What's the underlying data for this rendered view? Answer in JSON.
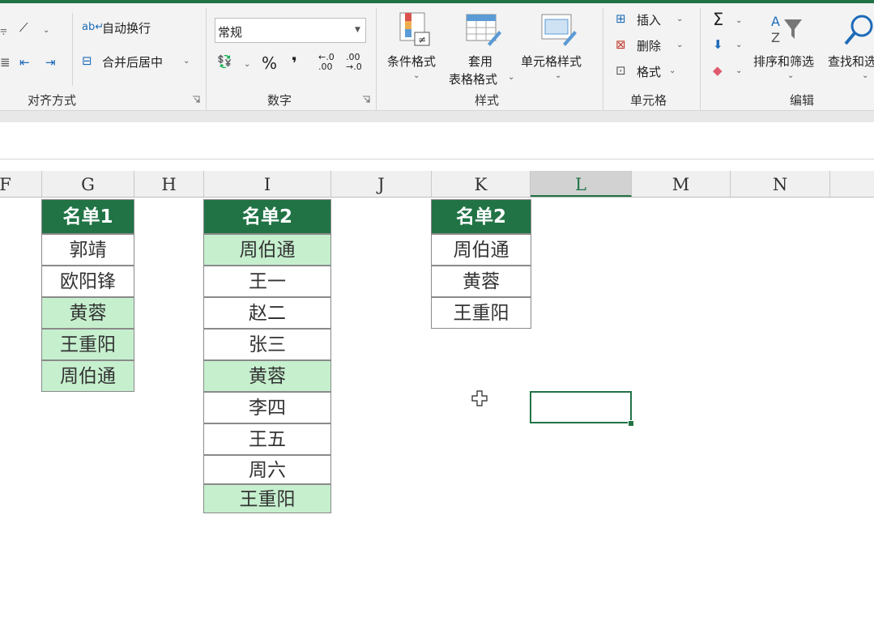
{
  "ribbon": {
    "alignment": {
      "label": "对齐方式",
      "wrap_text": "自动换行",
      "merge_center": "合并后居中"
    },
    "number": {
      "label": "数字",
      "format_value": "常规",
      "percent_symbol": "%",
      "comma_symbol": "❜"
    },
    "styles": {
      "label": "样式",
      "conditional_format": "条件格式",
      "table_format_line1": "套用",
      "table_format_line2": "表格格式",
      "cell_styles": "单元格样式"
    },
    "cells": {
      "label": "单元格",
      "insert": "插入",
      "delete": "删除",
      "format": "格式"
    },
    "editing": {
      "label": "编辑",
      "sum_symbol": "Σ",
      "sort_filter": "排序和筛选",
      "find_select": "查找和选"
    }
  },
  "columns": [
    "F",
    "G",
    "H",
    "I",
    "J",
    "K",
    "L",
    "M",
    "N"
  ],
  "selected_column": "L",
  "list1": {
    "header": "名单1",
    "items": [
      "郭靖",
      "欧阳锋",
      "黄蓉",
      "王重阳",
      "周伯通"
    ],
    "highlighted": [
      false,
      false,
      true,
      true,
      true
    ]
  },
  "list2": {
    "header": "名单2",
    "items": [
      "周伯通",
      "王一",
      "赵二",
      "张三",
      "黄蓉",
      "李四",
      "王五",
      "周六",
      "王重阳"
    ],
    "highlighted": [
      true,
      false,
      false,
      false,
      true,
      false,
      false,
      false,
      true
    ]
  },
  "result": {
    "header": "名单2",
    "items": [
      "周伯通",
      "黄蓉",
      "王重阳"
    ]
  },
  "colors": {
    "header_green": "#217346",
    "highlight_fill": "#c6efce"
  }
}
